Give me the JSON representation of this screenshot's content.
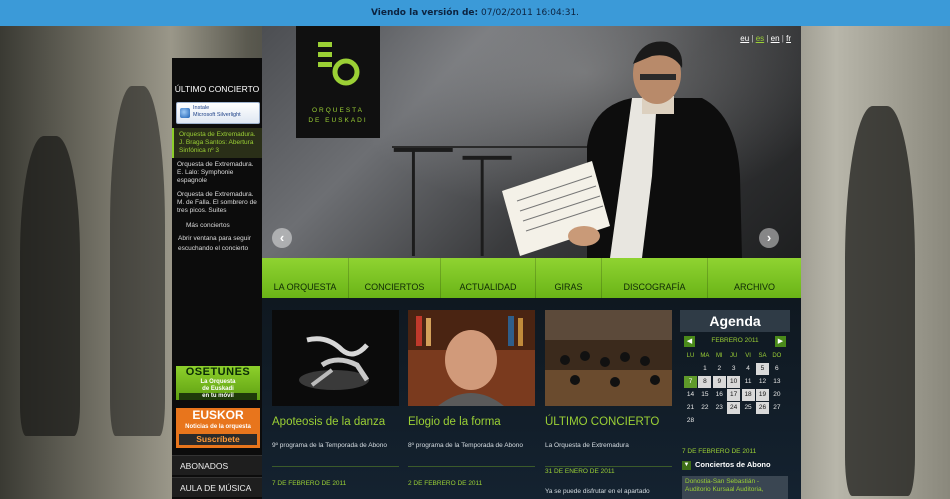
{
  "wayback": {
    "label": "Viendo la versión de:",
    "value": "07/02/2011 16:04:31."
  },
  "sidebar": {
    "heading": "ÚLTIMO CONCIERTO",
    "silverlight": {
      "line1": "Instale",
      "line2": "Microsoft Silverlight"
    },
    "concerts": [
      "Orquesta de Extremadura. J. Braga Santos: Abertura Sinfónica nº 3",
      "Orquesta de Extremadura. E. Lalo: Symphonie espagnole",
      "Orquesta de Extremadura. M. de Falla. El sombrero de tres picos. Suites"
    ],
    "more": "Más conciertos",
    "open_window": "Abrir ventana para seguir escuchando el concierto",
    "osetunes": {
      "title": "OSETUNES",
      "line1": "La Orquesta",
      "line2": "de Euskadi",
      "line3": "en tu móvil"
    },
    "euskor": {
      "title": "EUSKOR",
      "line1": "Noticias de la orquesta",
      "line2": "Suscríbete"
    },
    "links": [
      "ABONADOS",
      "AULA DE MÚSICA"
    ]
  },
  "hero": {
    "logo_text1": "ORQUESTA",
    "logo_text2": "DE EUSKADI",
    "languages": [
      "eu",
      "es",
      "en",
      "fr"
    ],
    "active_language": "es",
    "prev": "‹",
    "next": "›"
  },
  "nav": [
    "LA ORQUESTA",
    "CONCIERTOS",
    "ACTUALIDAD",
    "GIRAS",
    "DISCOGRAFÍA",
    "ARCHIVO"
  ],
  "news": [
    {
      "title": "Apoteosis de la danza",
      "text": "9º programa de la Temporada de Abono",
      "date": "7 DE FEBRERO DE 2011"
    },
    {
      "title": "Elogio de la forma",
      "text": "8º programa de la Temporada de Abono",
      "date": "2 DE FEBRERO DE 2011"
    },
    {
      "title": "ÚLTIMO CONCIERTO",
      "text": "La Orquesta de Extremadura",
      "date": "31 DE ENERO DE 2011",
      "extra": "Ya se puede disfrutar en el apartado"
    }
  ],
  "agenda": {
    "title": "Agenda",
    "month": "FEBRERO 2011",
    "dow": [
      "LU",
      "MA",
      "MI",
      "JU",
      "VI",
      "SA",
      "DO"
    ],
    "weeks": [
      [
        "",
        "1",
        "2",
        "3",
        "4",
        "5",
        "6"
      ],
      [
        "7",
        "8",
        "9",
        "10",
        "11",
        "12",
        "13"
      ],
      [
        "14",
        "15",
        "16",
        "17",
        "18",
        "19",
        "20"
      ],
      [
        "21",
        "22",
        "23",
        "24",
        "25",
        "26",
        "27"
      ],
      [
        "28",
        "",
        "",
        "",
        "",
        "",
        ""
      ]
    ],
    "highlighted": [
      "5",
      "8",
      "9",
      "10",
      "17",
      "18",
      "19",
      "24",
      "26"
    ],
    "today": "7",
    "date_label": "7 DE FEBRERO DE 2011",
    "section": "Conciertos de Abono",
    "event": "Donostia-San Sebastián - Auditorio Kursaal Auditoria,"
  }
}
